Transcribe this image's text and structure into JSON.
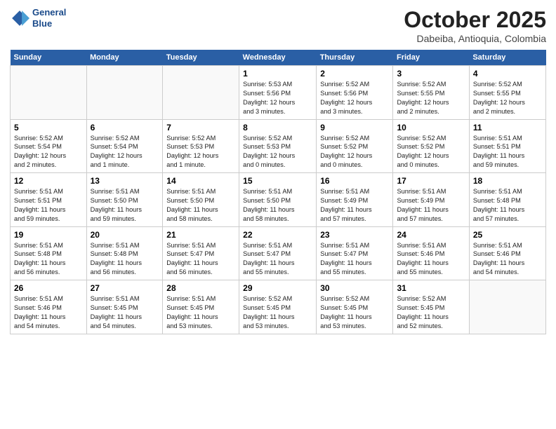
{
  "header": {
    "logo_line1": "General",
    "logo_line2": "Blue",
    "month": "October 2025",
    "location": "Dabeiba, Antioquia, Colombia"
  },
  "days_of_week": [
    "Sunday",
    "Monday",
    "Tuesday",
    "Wednesday",
    "Thursday",
    "Friday",
    "Saturday"
  ],
  "weeks": [
    [
      {
        "day": "",
        "info": ""
      },
      {
        "day": "",
        "info": ""
      },
      {
        "day": "",
        "info": ""
      },
      {
        "day": "1",
        "info": "Sunrise: 5:53 AM\nSunset: 5:56 PM\nDaylight: 12 hours\nand 3 minutes."
      },
      {
        "day": "2",
        "info": "Sunrise: 5:52 AM\nSunset: 5:56 PM\nDaylight: 12 hours\nand 3 minutes."
      },
      {
        "day": "3",
        "info": "Sunrise: 5:52 AM\nSunset: 5:55 PM\nDaylight: 12 hours\nand 2 minutes."
      },
      {
        "day": "4",
        "info": "Sunrise: 5:52 AM\nSunset: 5:55 PM\nDaylight: 12 hours\nand 2 minutes."
      }
    ],
    [
      {
        "day": "5",
        "info": "Sunrise: 5:52 AM\nSunset: 5:54 PM\nDaylight: 12 hours\nand 2 minutes."
      },
      {
        "day": "6",
        "info": "Sunrise: 5:52 AM\nSunset: 5:54 PM\nDaylight: 12 hours\nand 1 minute."
      },
      {
        "day": "7",
        "info": "Sunrise: 5:52 AM\nSunset: 5:53 PM\nDaylight: 12 hours\nand 1 minute."
      },
      {
        "day": "8",
        "info": "Sunrise: 5:52 AM\nSunset: 5:53 PM\nDaylight: 12 hours\nand 0 minutes."
      },
      {
        "day": "9",
        "info": "Sunrise: 5:52 AM\nSunset: 5:52 PM\nDaylight: 12 hours\nand 0 minutes."
      },
      {
        "day": "10",
        "info": "Sunrise: 5:52 AM\nSunset: 5:52 PM\nDaylight: 12 hours\nand 0 minutes."
      },
      {
        "day": "11",
        "info": "Sunrise: 5:51 AM\nSunset: 5:51 PM\nDaylight: 11 hours\nand 59 minutes."
      }
    ],
    [
      {
        "day": "12",
        "info": "Sunrise: 5:51 AM\nSunset: 5:51 PM\nDaylight: 11 hours\nand 59 minutes."
      },
      {
        "day": "13",
        "info": "Sunrise: 5:51 AM\nSunset: 5:50 PM\nDaylight: 11 hours\nand 59 minutes."
      },
      {
        "day": "14",
        "info": "Sunrise: 5:51 AM\nSunset: 5:50 PM\nDaylight: 11 hours\nand 58 minutes."
      },
      {
        "day": "15",
        "info": "Sunrise: 5:51 AM\nSunset: 5:50 PM\nDaylight: 11 hours\nand 58 minutes."
      },
      {
        "day": "16",
        "info": "Sunrise: 5:51 AM\nSunset: 5:49 PM\nDaylight: 11 hours\nand 57 minutes."
      },
      {
        "day": "17",
        "info": "Sunrise: 5:51 AM\nSunset: 5:49 PM\nDaylight: 11 hours\nand 57 minutes."
      },
      {
        "day": "18",
        "info": "Sunrise: 5:51 AM\nSunset: 5:48 PM\nDaylight: 11 hours\nand 57 minutes."
      }
    ],
    [
      {
        "day": "19",
        "info": "Sunrise: 5:51 AM\nSunset: 5:48 PM\nDaylight: 11 hours\nand 56 minutes."
      },
      {
        "day": "20",
        "info": "Sunrise: 5:51 AM\nSunset: 5:48 PM\nDaylight: 11 hours\nand 56 minutes."
      },
      {
        "day": "21",
        "info": "Sunrise: 5:51 AM\nSunset: 5:47 PM\nDaylight: 11 hours\nand 56 minutes."
      },
      {
        "day": "22",
        "info": "Sunrise: 5:51 AM\nSunset: 5:47 PM\nDaylight: 11 hours\nand 55 minutes."
      },
      {
        "day": "23",
        "info": "Sunrise: 5:51 AM\nSunset: 5:47 PM\nDaylight: 11 hours\nand 55 minutes."
      },
      {
        "day": "24",
        "info": "Sunrise: 5:51 AM\nSunset: 5:46 PM\nDaylight: 11 hours\nand 55 minutes."
      },
      {
        "day": "25",
        "info": "Sunrise: 5:51 AM\nSunset: 5:46 PM\nDaylight: 11 hours\nand 54 minutes."
      }
    ],
    [
      {
        "day": "26",
        "info": "Sunrise: 5:51 AM\nSunset: 5:46 PM\nDaylight: 11 hours\nand 54 minutes."
      },
      {
        "day": "27",
        "info": "Sunrise: 5:51 AM\nSunset: 5:45 PM\nDaylight: 11 hours\nand 54 minutes."
      },
      {
        "day": "28",
        "info": "Sunrise: 5:51 AM\nSunset: 5:45 PM\nDaylight: 11 hours\nand 53 minutes."
      },
      {
        "day": "29",
        "info": "Sunrise: 5:52 AM\nSunset: 5:45 PM\nDaylight: 11 hours\nand 53 minutes."
      },
      {
        "day": "30",
        "info": "Sunrise: 5:52 AM\nSunset: 5:45 PM\nDaylight: 11 hours\nand 53 minutes."
      },
      {
        "day": "31",
        "info": "Sunrise: 5:52 AM\nSunset: 5:45 PM\nDaylight: 11 hours\nand 52 minutes."
      },
      {
        "day": "",
        "info": ""
      }
    ]
  ]
}
